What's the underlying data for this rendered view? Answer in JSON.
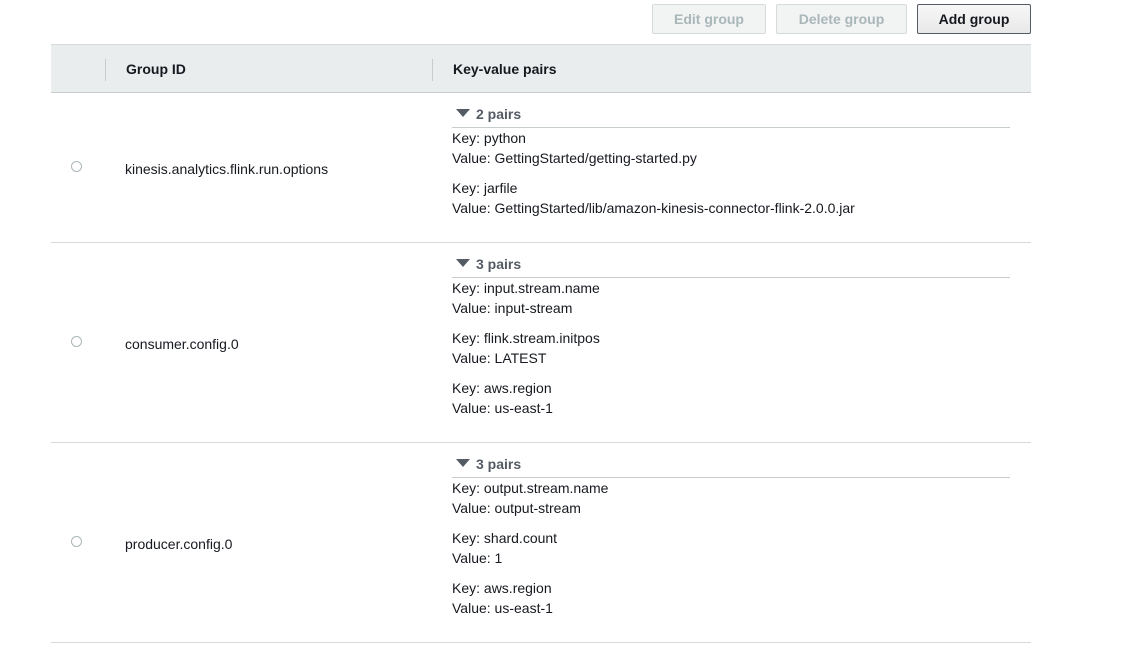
{
  "toolbar": {
    "edit_label": "Edit group",
    "delete_label": "Delete group",
    "add_label": "Add group"
  },
  "table": {
    "headers": {
      "group_id": "Group ID",
      "kv_pairs": "Key-value pairs"
    },
    "rows": [
      {
        "group_id": "kinesis.analytics.flink.run.options",
        "pairs_count": "2 pairs",
        "pairs": [
          {
            "key": "Key: python",
            "value": "Value: GettingStarted/getting-started.py"
          },
          {
            "key": "Key: jarfile",
            "value": "Value: GettingStarted/lib/amazon-kinesis-connector-flink-2.0.0.jar"
          }
        ]
      },
      {
        "group_id": "consumer.config.0",
        "pairs_count": "3 pairs",
        "pairs": [
          {
            "key": "Key: input.stream.name",
            "value": "Value: input-stream"
          },
          {
            "key": "Key: flink.stream.initpos",
            "value": "Value: LATEST"
          },
          {
            "key": "Key: aws.region",
            "value": "Value: us-east-1"
          }
        ]
      },
      {
        "group_id": "producer.config.0",
        "pairs_count": "3 pairs",
        "pairs": [
          {
            "key": "Key: output.stream.name",
            "value": "Value: output-stream"
          },
          {
            "key": "Key: shard.count",
            "value": "Value: 1"
          },
          {
            "key": "Key: aws.region",
            "value": "Value: us-east-1"
          }
        ]
      }
    ]
  }
}
